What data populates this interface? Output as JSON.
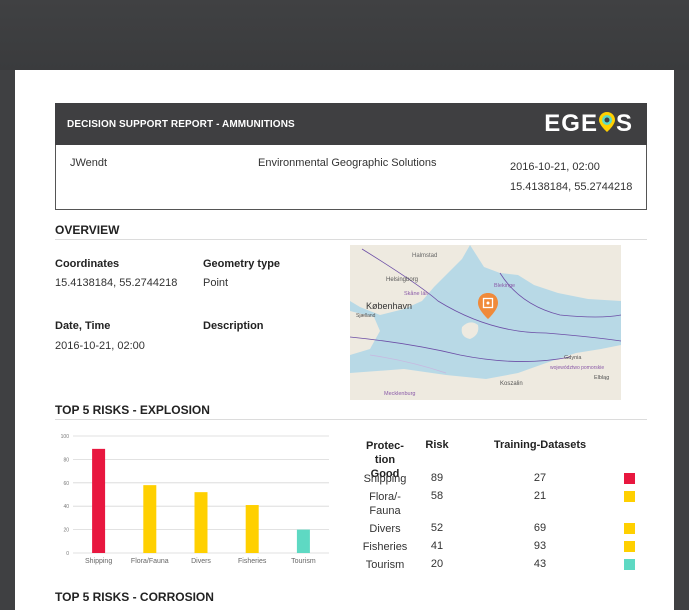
{
  "report": {
    "title": "DECISION SUPPORT REPORT - AMMUNITIONS",
    "logo": {
      "left": "EGE",
      "right": "S"
    },
    "user": "JWendt",
    "company": "Environmental Geographic Solutions",
    "datetime": "2016-10-21, 02:00",
    "coords": "15.4138184, 55.2744218"
  },
  "overview": {
    "heading": "OVERVIEW",
    "coordinates_label": "Coordinates",
    "coordinates_value": "15.4138184, 55.2744218",
    "geometry_label": "Geometry type",
    "geometry_value": "Point",
    "datetime_label": "Date, Time",
    "datetime_value": "2016-10-21, 02:00",
    "description_label": "Description"
  },
  "map": {
    "labels": [
      "Halmstad",
      "Helsingborg",
      "Blekinge",
      "Skåne län",
      "København",
      "Sjælland",
      "Gdynia",
      "województwo pomorskie",
      "Elbląg",
      "Koszalin",
      "Mecklenburg"
    ]
  },
  "explosion": {
    "heading": "TOP 5 RISKS - EXPLOSION",
    "table": {
      "headers": [
        "Protec-tion Good",
        "Risk",
        "Training-Datasets"
      ],
      "rows": [
        {
          "good": "Shipping",
          "risk": "89",
          "training": "27",
          "color": "#e8173f"
        },
        {
          "good": "Flora/-Fauna",
          "risk": "58",
          "training": "21",
          "color": "#ffd000"
        },
        {
          "good": "Divers",
          "risk": "52",
          "training": "69",
          "color": "#ffd000"
        },
        {
          "good": "Fisheries",
          "risk": "41",
          "training": "93",
          "color": "#ffd000"
        },
        {
          "good": "Tourism",
          "risk": "20",
          "training": "43",
          "color": "#5ed9c3"
        }
      ]
    }
  },
  "corrosion": {
    "heading": "TOP 5 RISKS - CORROSION"
  },
  "chart_data": {
    "type": "bar",
    "categories": [
      "Shipping",
      "Flora/Fauna",
      "Divers",
      "Fisheries",
      "Tourism"
    ],
    "values": [
      89,
      58,
      52,
      41,
      20
    ],
    "colors": [
      "#e8173f",
      "#ffd000",
      "#ffd000",
      "#ffd000",
      "#5ed9c3"
    ],
    "ylim": [
      0,
      100
    ],
    "yticks": [
      "0",
      "20",
      "40",
      "60",
      "80",
      "100"
    ],
    "grid": true
  }
}
